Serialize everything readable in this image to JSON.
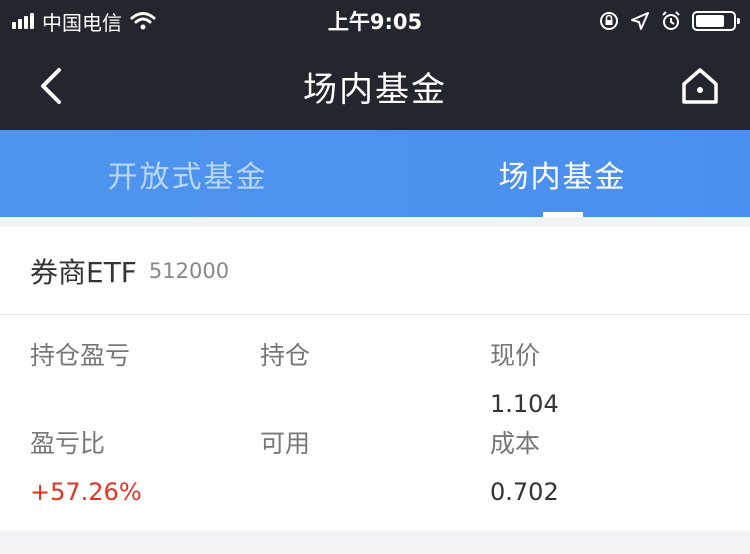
{
  "status_bar": {
    "carrier": "中国电信",
    "time": "上午9:05"
  },
  "nav": {
    "title": "场内基金"
  },
  "tabs": [
    {
      "label": "开放式基金",
      "active": false
    },
    {
      "label": "场内基金",
      "active": true
    }
  ],
  "fund": {
    "name": "券商ETF",
    "code": "512000",
    "fields": {
      "holding_pnl": {
        "label": "持仓盈亏",
        "value": ""
      },
      "position": {
        "label": "持仓",
        "value": ""
      },
      "current_price": {
        "label": "现价",
        "value": "1.104"
      },
      "pnl_ratio": {
        "label": "盈亏比",
        "value": "+57.26%"
      },
      "available": {
        "label": "可用",
        "value": ""
      },
      "cost": {
        "label": "成本",
        "value": "0.702"
      }
    }
  },
  "colors": {
    "header_bg": "#23252f",
    "tab_bg": "#4f94ec",
    "positive": "#e8321e"
  },
  "icons": [
    "back-arrow-icon",
    "home-icon",
    "signal-icon",
    "wifi-icon",
    "lock-rotation-icon",
    "location-icon",
    "alarm-icon",
    "battery-icon"
  ]
}
